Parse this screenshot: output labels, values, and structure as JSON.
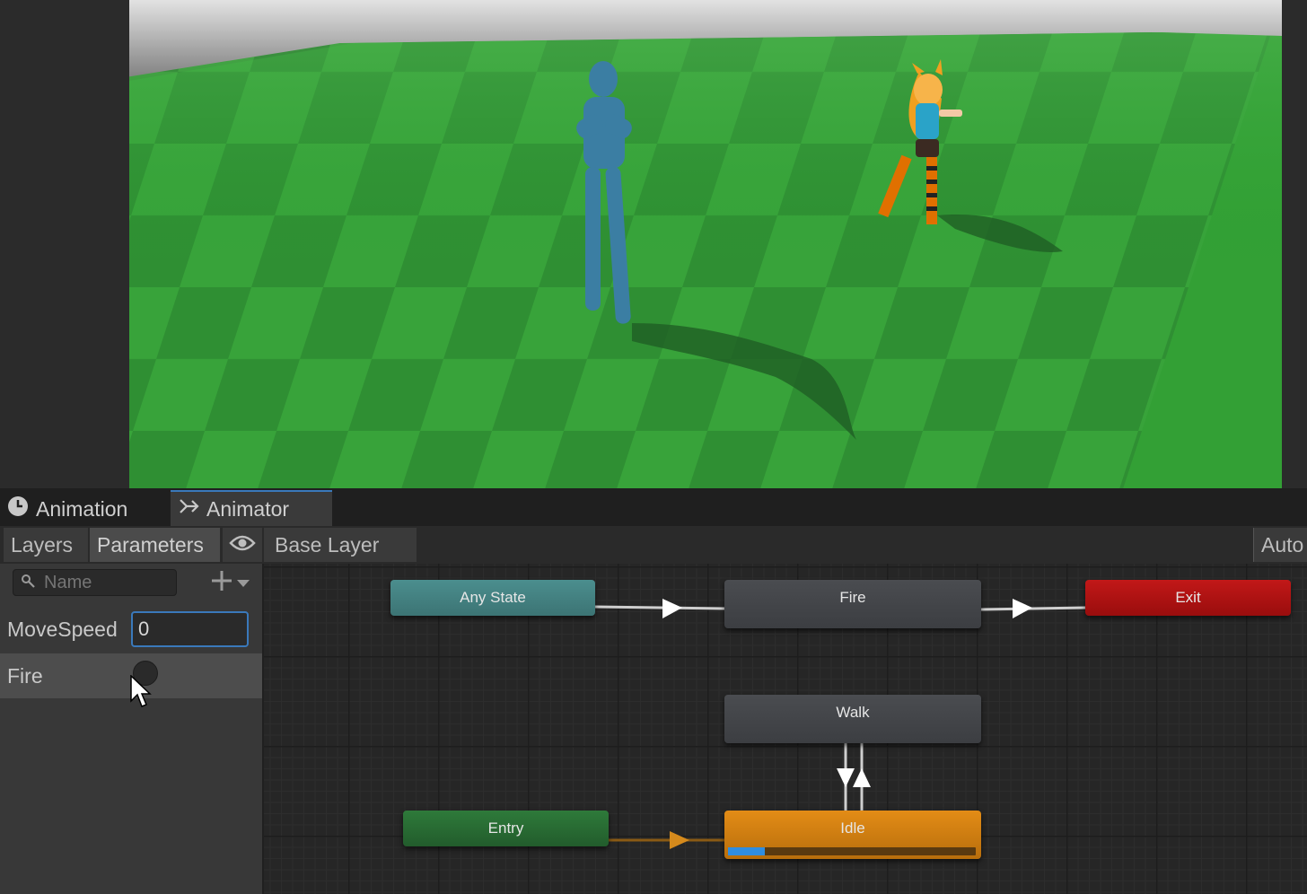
{
  "tabs": {
    "animation": "Animation",
    "animator": "Animator"
  },
  "toolbar": {
    "layers": "Layers",
    "parameters": "Parameters",
    "breadcrumb": "Base Layer",
    "auto": "Auto"
  },
  "parameters": {
    "search_placeholder": "Name",
    "items": [
      {
        "name": "MoveSpeed",
        "type": "float",
        "value": "0"
      },
      {
        "name": "Fire",
        "type": "trigger",
        "value": false
      }
    ]
  },
  "graph": {
    "nodes": {
      "any_state": "Any State",
      "fire": "Fire",
      "exit": "Exit",
      "walk": "Walk",
      "entry": "Entry",
      "idle": "Idle"
    },
    "idle_progress": 0.15
  },
  "colors": {
    "accent": "#3a79bb",
    "any_state": "#4b8e8e",
    "exit": "#c21818",
    "entry": "#2e7a3a",
    "idle": "#e38c16",
    "state": "#45474b"
  },
  "icons": {
    "animation_tab": "clock-icon",
    "animator_tab": "state-machine-icon",
    "visibility": "eye-icon",
    "search": "search-icon",
    "add": "plus-icon",
    "cursor": "mouse-cursor-icon"
  }
}
